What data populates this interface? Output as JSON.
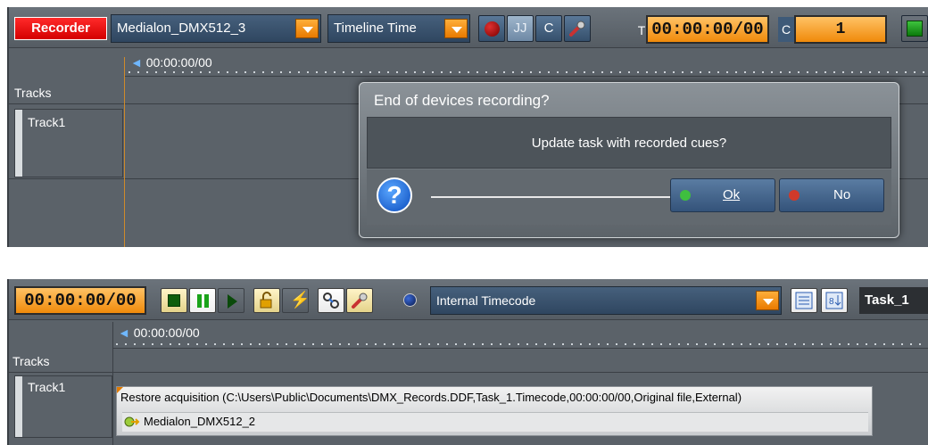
{
  "top": {
    "badge": "Recorder",
    "device_select": "Medialon_DMX512_3",
    "time_select": "Timeline Time",
    "buttons": {
      "pause": "JJ",
      "c": "C"
    },
    "timecode": {
      "prefix": "T",
      "value": "00:00:00/00"
    },
    "counter": {
      "prefix": "C",
      "value": "1"
    },
    "ruler_time": "00:00:00/00",
    "tracks_header": "Tracks",
    "track_name": "Track1"
  },
  "dialog": {
    "title": "End of devices recording?",
    "message": "Update task with recorded cues?",
    "help_glyph": "?",
    "ok_label": "Ok",
    "no_label": "No",
    "ok_led_color": "#3fbf3f",
    "no_led_color": "#d03a2a"
  },
  "bottom": {
    "timecode": "00:00:00/00",
    "timecode_source": "Internal Timecode",
    "task_name": "Task_1",
    "ruler_time": "00:00:00/00",
    "tracks_header": "Tracks",
    "track_name": "Track1",
    "clip_title": "Restore acquisition (C:\\Users\\Public\\Documents\\DMX_Records.DDF,Task_1.Timecode,00:00:00/00,Original file,External)",
    "clip_device": "Medialon_DMX512_2"
  },
  "colors": {
    "panel": "#5b6269",
    "accent_orange": "#f08a0a",
    "record_red": "#d40000",
    "button_blue": "#35506c"
  }
}
